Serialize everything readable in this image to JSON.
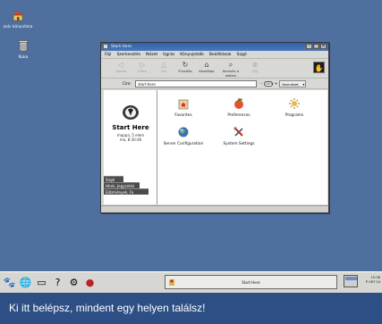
{
  "desktop": {
    "icons": [
      {
        "label": "zolc könyvtára",
        "icon": "home-folder-icon"
      },
      {
        "label": "Kuka",
        "icon": "trash-icon"
      }
    ]
  },
  "window": {
    "title": "Start Here",
    "menu": [
      "Fájl",
      "Szerkesztés",
      "Nézet",
      "Ugrás",
      "Könyvjelzők",
      "Beállítások",
      "Súgó"
    ],
    "toolbar": [
      {
        "label": "Vissza",
        "icon": "back-arrow-icon",
        "enabled": false
      },
      {
        "label": "Előre",
        "icon": "forward-arrow-icon",
        "enabled": false
      },
      {
        "label": "Fel",
        "icon": "up-arrow-icon",
        "enabled": false
      },
      {
        "label": "Frissítés",
        "icon": "reload-icon",
        "enabled": true
      },
      {
        "label": "Kezdőlap",
        "icon": "home-icon",
        "enabled": true
      },
      {
        "label": "Keresés a weben",
        "icon": "web-search-icon",
        "enabled": true
      },
      {
        "label": "Állj",
        "icon": "stop-icon",
        "enabled": false
      }
    ],
    "location": {
      "label": "Cím:",
      "value": "start-here",
      "zoom": "100%",
      "view": "Ikonnézet"
    },
    "sidepane": {
      "title": "Start Here",
      "info_line1": "mappa, 5 elem",
      "info_line2": "ma, 8:30:46",
      "tabs": [
        "Súgó",
        "Hírek, Jegyzetek",
        "Előzmények, Fa"
      ]
    },
    "items": [
      {
        "label": "Favorites",
        "icon": "favorites-icon"
      },
      {
        "label": "Preferences",
        "icon": "preferences-icon"
      },
      {
        "label": "Programs",
        "icon": "programs-icon"
      },
      {
        "label": "Server Configuration",
        "icon": "server-config-icon"
      },
      {
        "label": "System Settings",
        "icon": "system-settings-icon"
      }
    ]
  },
  "panel": {
    "launchers": [
      "gnome-foot-icon",
      "mozilla-icon",
      "terminal-icon",
      "help-icon",
      "settings-icon",
      "redhat-icon"
    ],
    "task_label": "Start Here",
    "clock_time": "15:38",
    "clock_date": "P OKT 24"
  },
  "caption": "Ki itt belépsz, mindent egy helyen találsz!",
  "colors": {
    "desktop": "#4f6f9f",
    "titlebar": "#2f5fa6",
    "caption_bg": "#2d4f86"
  }
}
